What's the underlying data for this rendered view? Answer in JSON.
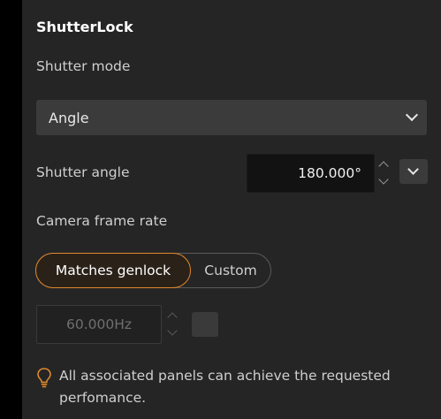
{
  "panel": {
    "title": "ShutterLock"
  },
  "shutter_mode": {
    "label": "Shutter mode",
    "selected": "Angle",
    "chevron_icon": "chevron-down-icon"
  },
  "shutter_angle": {
    "label": "Shutter angle",
    "value": "180.000°"
  },
  "frame_rate": {
    "label": "Camera frame rate",
    "options": [
      {
        "label": "Matches genlock",
        "active": true
      },
      {
        "label": "Custom",
        "active": false
      }
    ],
    "value": "60.000Hz",
    "disabled": true
  },
  "note": {
    "icon": "lightbulb-icon",
    "text": "All associated panels can achieve the requested perfomance."
  },
  "colors": {
    "accent": "#e0892a",
    "panel_bg": "#252525",
    "field_bg": "#121212"
  }
}
